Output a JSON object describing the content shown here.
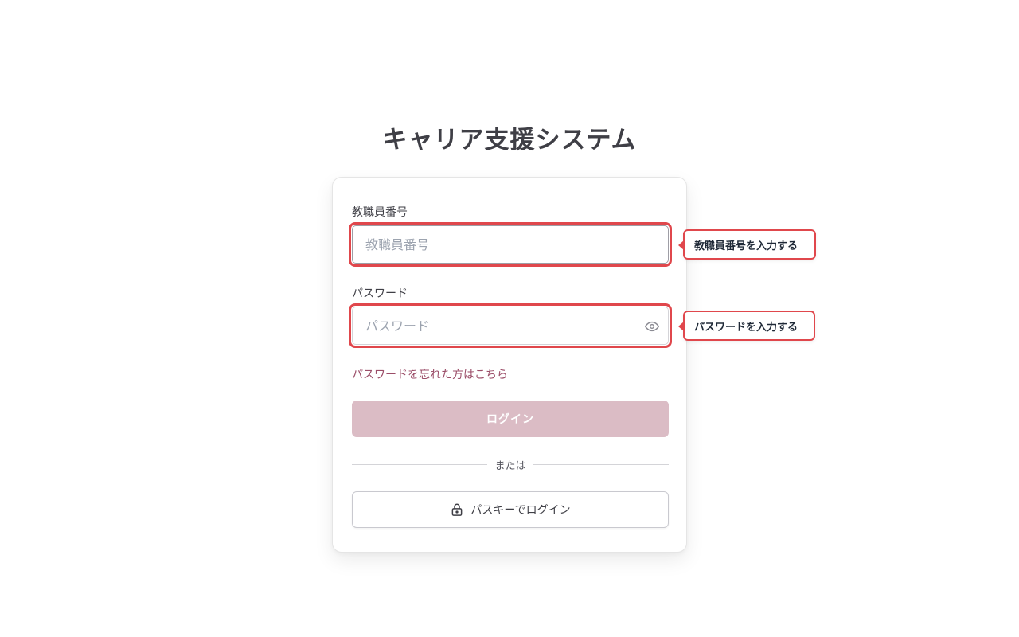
{
  "app": {
    "title": "キャリア支援システム"
  },
  "form": {
    "staff_id": {
      "label": "教職員番号",
      "placeholder": "教職員番号",
      "value": ""
    },
    "password": {
      "label": "パスワード",
      "placeholder": "パスワード",
      "value": "",
      "toggle_icon": "eye-icon"
    },
    "forgot_link": "パスワードを忘れた方はこちら",
    "login_button": "ログイン",
    "divider_text": "または",
    "passkey_button": "パスキーでログイン",
    "passkey_icon": "lock-icon"
  },
  "annotations": {
    "staff_id_callout": "教職員番号を入力する",
    "password_callout": "パスワードを入力する",
    "highlight_color": "#e0474c"
  },
  "colors": {
    "accent": "#9b4d68",
    "login_button_bg": "#dbbcc5",
    "title_text": "#3f3f46"
  }
}
